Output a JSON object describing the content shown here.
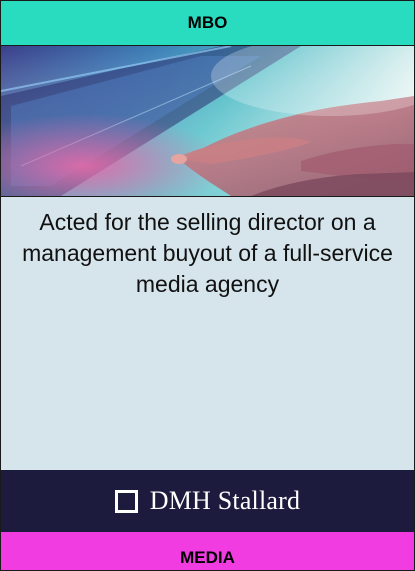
{
  "card": {
    "category_label": "MBO",
    "description": "Acted for the selling director on a management buyout of a full-service media agency",
    "brand_name": "DMH Stallard",
    "sector_label": "MEDIA"
  },
  "colors": {
    "category_bar": "#29dcc0",
    "body_background": "#d6e4ec",
    "brand_bar": "#1c1b3e",
    "sector_bar": "#f03ce1"
  },
  "image": {
    "subject": "hand-touching-tablet-screen-photo"
  }
}
